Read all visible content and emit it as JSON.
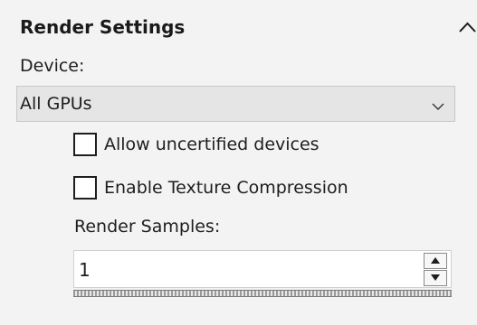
{
  "section": {
    "title": "Render Settings",
    "collapse_icon": "chevron-up-icon"
  },
  "device": {
    "label": "Device:",
    "selected": "All GPUs",
    "dropdown_icon": "chevron-down-icon"
  },
  "options": [
    {
      "label": "Allow uncertified devices",
      "checked": false
    },
    {
      "label": "Enable Texture Compression",
      "checked": false
    }
  ],
  "render_samples": {
    "label": "Render Samples:",
    "value": "1"
  },
  "colors": {
    "background": "#f3f3f3",
    "dropdown_bg": "#e5e5e5",
    "text": "#1e1e1e"
  }
}
